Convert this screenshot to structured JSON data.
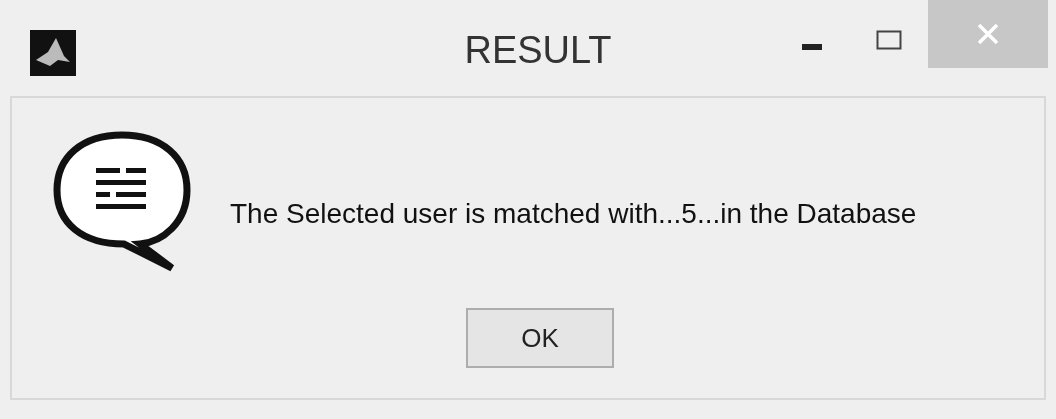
{
  "window": {
    "title": "RESULT"
  },
  "message": "The Selected user is matched with...5...in the Database",
  "buttons": [
    "OK"
  ]
}
